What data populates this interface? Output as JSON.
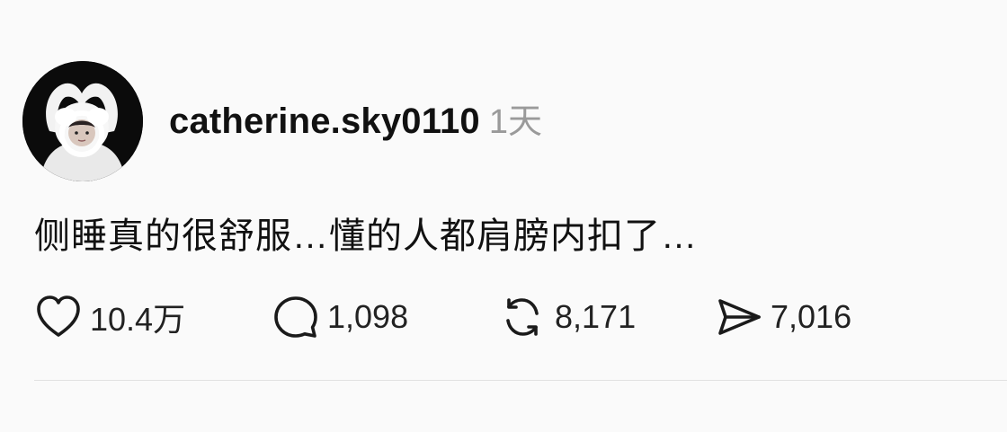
{
  "post": {
    "avatar_icon": "avatar-photo",
    "username": "catherine.sky0110",
    "time": "1天",
    "content": "侧睡真的很舒服…懂的人都肩膀内扣了…"
  },
  "actions": {
    "like": {
      "icon": "heart-icon",
      "count": "10.4万"
    },
    "comment": {
      "icon": "comment-bubble-icon",
      "count": "1,098"
    },
    "repost": {
      "icon": "repost-icon",
      "count": "8,171"
    },
    "share": {
      "icon": "send-icon",
      "count": "7,016"
    }
  },
  "colors": {
    "background": "#fafafa",
    "text": "#111111",
    "secondary_text": "#9a9a9a",
    "divider": "#e2e2e2"
  }
}
